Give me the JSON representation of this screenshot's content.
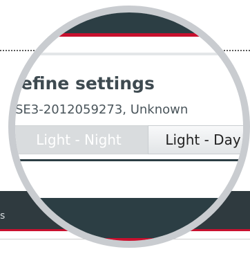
{
  "page": {
    "title": "efine settings",
    "subtitle": "SE3-2012059273, Unknown"
  },
  "buttons": {
    "night_label": "Light - Night",
    "day_label": "Light - Day"
  },
  "footer": {
    "fragment": "s"
  }
}
